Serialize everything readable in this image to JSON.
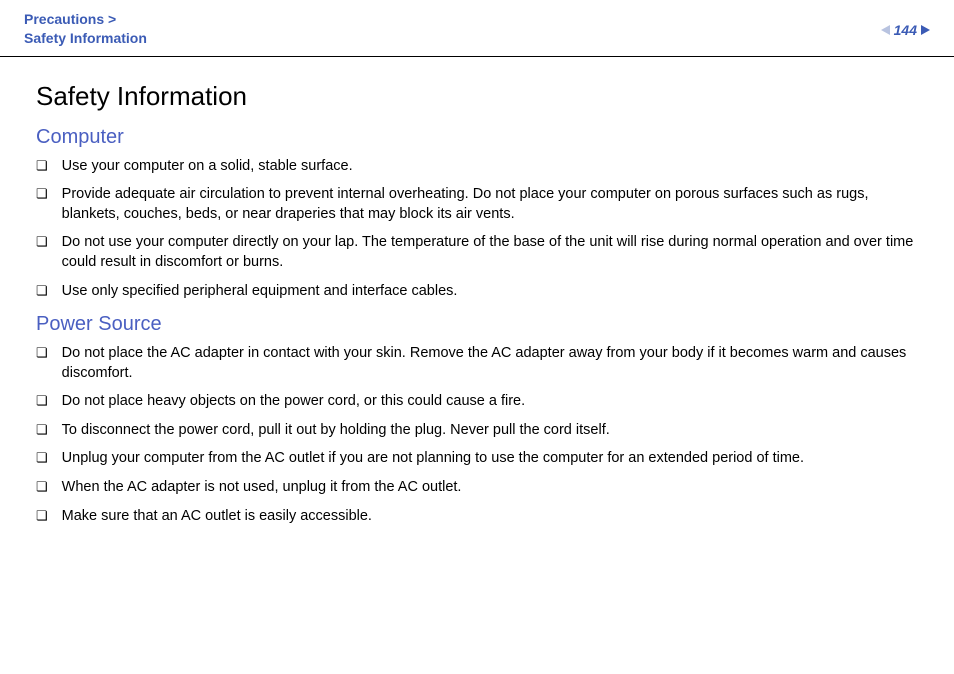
{
  "header": {
    "breadcrumb_line1": "Precautions >",
    "breadcrumb_line2": "Safety Information",
    "page_number": "144"
  },
  "title": "Safety Information",
  "sections": [
    {
      "heading": "Computer",
      "items": [
        "Use your computer on a solid, stable surface.",
        "Provide adequate air circulation to prevent internal overheating. Do not place your computer on porous surfaces such as rugs, blankets, couches, beds, or near draperies that may block its air vents.",
        "Do not use your computer directly on your lap. The temperature of the base of the unit will rise during normal operation and over time could result in discomfort or burns.",
        "Use only specified peripheral equipment and interface cables."
      ]
    },
    {
      "heading": "Power Source",
      "items": [
        "Do not place the AC adapter in contact with your skin. Remove the AC adapter away from your body if it becomes warm and causes discomfort.",
        "Do not place heavy objects on the power cord, or this could cause a fire.",
        "To disconnect the power cord, pull it out by holding the plug. Never pull the cord itself.",
        "Unplug your computer from the AC outlet if you are not planning to use the computer for an extended period of time.",
        "When the AC adapter is not used, unplug it from the AC outlet.",
        "Make sure that an AC outlet is easily accessible."
      ]
    }
  ]
}
